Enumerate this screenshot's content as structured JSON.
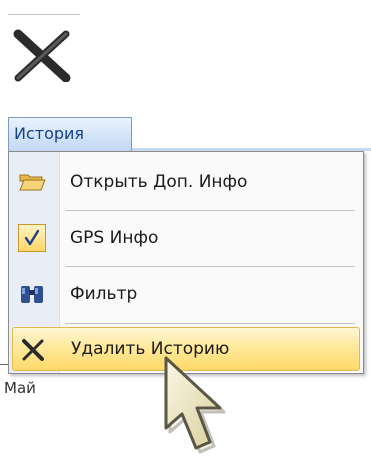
{
  "menu": {
    "tab_label": "История",
    "items": [
      {
        "label": "Открыть Доп. Инфо",
        "icon": "folder-open-icon"
      },
      {
        "label": "GPS Инфо",
        "icon": "checkmark-icon",
        "checked": true
      },
      {
        "label": "Фильтр",
        "icon": "binoculars-icon"
      },
      {
        "label": "Удалить Историю",
        "icon": "delete-x-icon",
        "highlighted": true
      }
    ]
  },
  "background": {
    "partial_text": "Май"
  },
  "colors": {
    "tab_text": "#15428b",
    "highlight": "#ffe99c",
    "check_fill": "#ffd76a"
  }
}
